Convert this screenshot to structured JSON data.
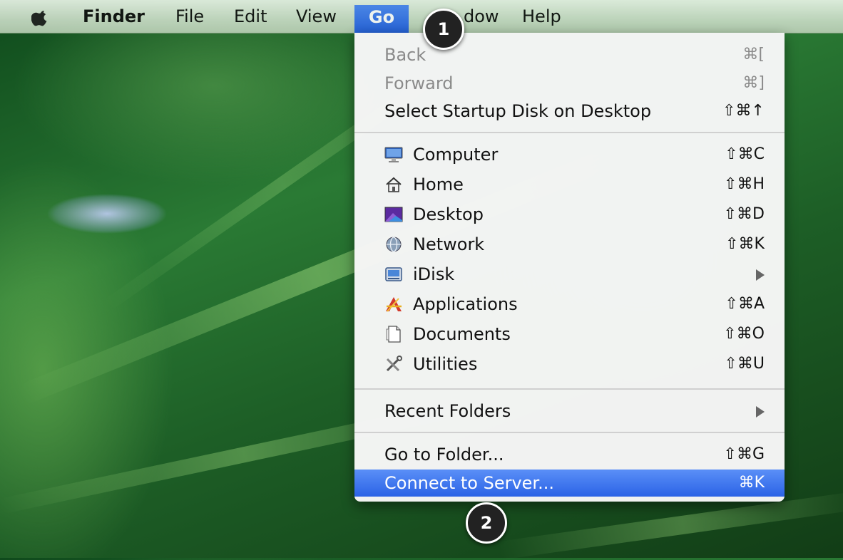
{
  "menubar": {
    "items": [
      "Finder",
      "File",
      "Edit",
      "View",
      "Go",
      "dow",
      "Help"
    ]
  },
  "menu": {
    "items": [
      {
        "label": "Back",
        "shortcut": "⌘[",
        "state": "disabled"
      },
      {
        "label": "Forward",
        "shortcut": "⌘]",
        "state": "disabled"
      },
      {
        "label": "Select Startup Disk on Desktop",
        "shortcut": "⇧⌘↑"
      },
      {
        "label": "Computer",
        "shortcut": "⇧⌘C",
        "icon": "computer-icon"
      },
      {
        "label": "Home",
        "shortcut": "⇧⌘H",
        "icon": "home-icon"
      },
      {
        "label": "Desktop",
        "shortcut": "⇧⌘D",
        "icon": "desktop-icon"
      },
      {
        "label": "Network",
        "shortcut": "⇧⌘K",
        "icon": "network-icon"
      },
      {
        "label": "iDisk",
        "submenu": true,
        "icon": "idisk-icon"
      },
      {
        "label": "Applications",
        "shortcut": "⇧⌘A",
        "icon": "applications-icon"
      },
      {
        "label": "Documents",
        "shortcut": "⇧⌘O",
        "icon": "documents-icon"
      },
      {
        "label": "Utilities",
        "shortcut": "⇧⌘U",
        "icon": "utilities-icon"
      },
      {
        "label": "Recent Folders",
        "submenu": true
      },
      {
        "label": "Go to Folder...",
        "shortcut": "⇧⌘G"
      },
      {
        "label": "Connect to Server...",
        "shortcut": "⌘K",
        "state": "selected"
      }
    ]
  },
  "callouts": [
    "1",
    "2"
  ],
  "colors": {
    "highlight": "#2b63e6",
    "callout": "#222222"
  }
}
